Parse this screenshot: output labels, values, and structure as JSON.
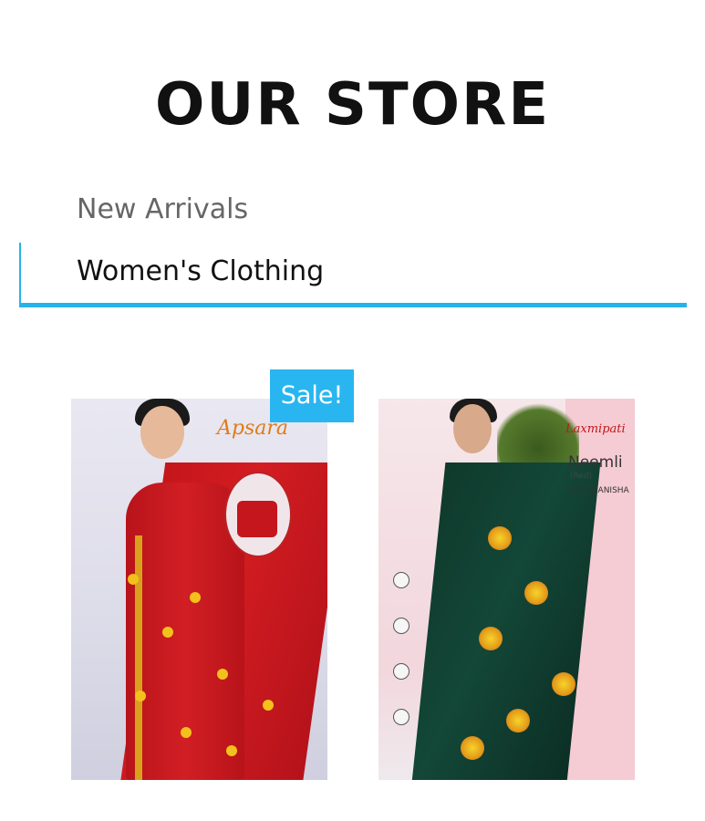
{
  "store": {
    "title": "OUR STORE"
  },
  "tabs": [
    {
      "label": "New Arrivals",
      "active": false
    },
    {
      "label": "Women's Clothing",
      "active": true
    }
  ],
  "accent_color": "#27b3ea",
  "products": [
    {
      "badge": "Sale!",
      "image_brand": "Apsara",
      "main_color": "#c4161c"
    },
    {
      "image_brand": "Laxmipati",
      "image_name": "Neemli",
      "image_sub": "(Red)",
      "image_code": "6374 DANISHA",
      "main_color": "#0f3a2c"
    }
  ]
}
